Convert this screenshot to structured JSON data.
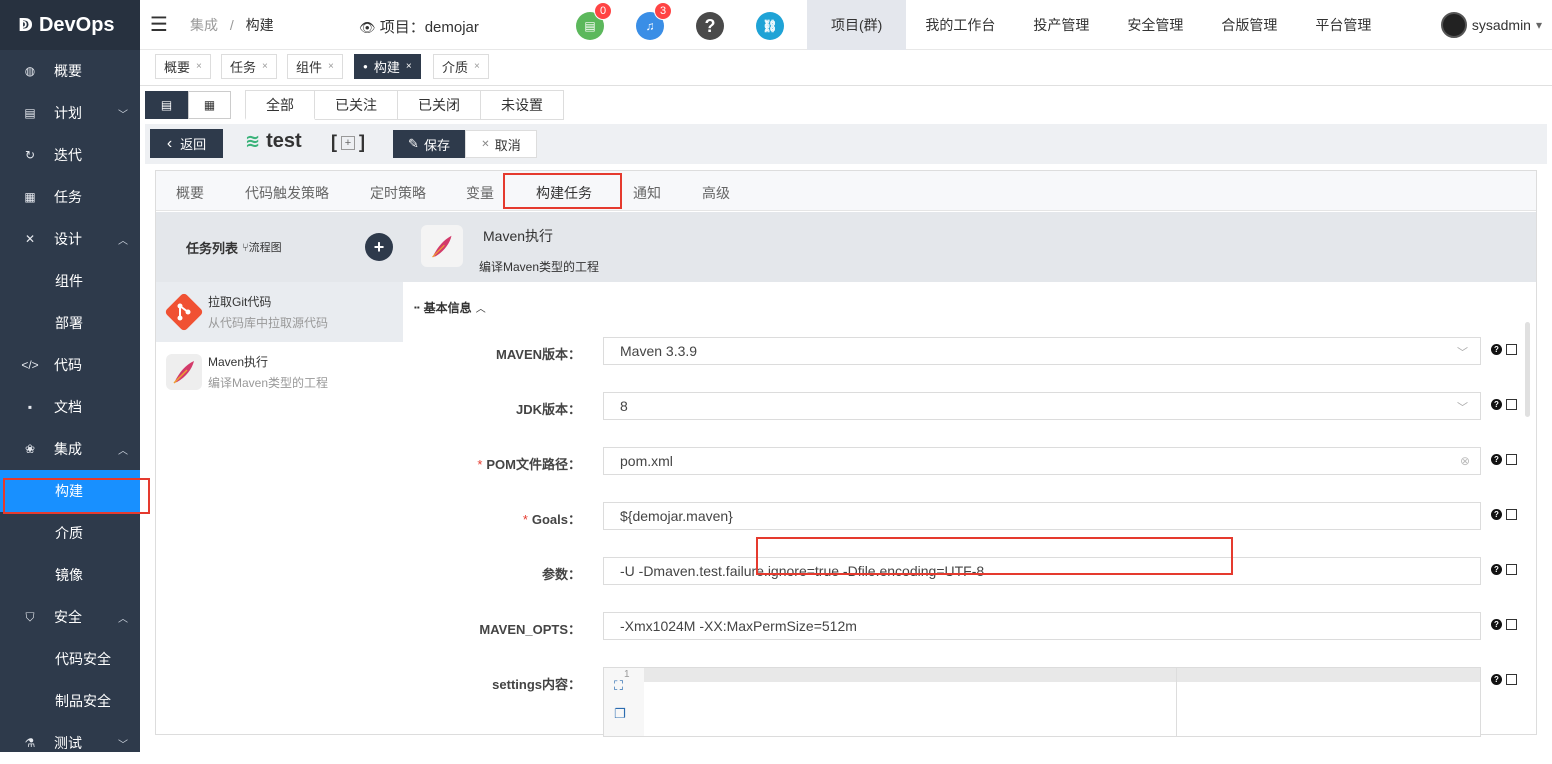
{
  "app": {
    "logo_mark": "ↁ",
    "logo_text": "DevOps"
  },
  "sidebar": {
    "items": [
      {
        "label": "概要",
        "icon": "dashboard-icon",
        "glyph": "◍"
      },
      {
        "label": "计划",
        "icon": "plan-icon",
        "glyph": "▤",
        "chevron": "﹀"
      },
      {
        "label": "迭代",
        "icon": "iteration-icon",
        "glyph": "↻"
      },
      {
        "label": "任务",
        "icon": "task-icon",
        "glyph": "▦"
      },
      {
        "label": "设计",
        "icon": "design-icon",
        "glyph": "✕",
        "chevron": "︿"
      },
      {
        "label": "组件"
      },
      {
        "label": "部署"
      },
      {
        "label": "代码",
        "icon": "code-icon",
        "glyph": "</>"
      },
      {
        "label": "文档",
        "icon": "doc-icon",
        "glyph": "▪"
      },
      {
        "label": "集成",
        "icon": "integration-icon",
        "glyph": "❀",
        "chevron": "︿"
      },
      {
        "label": "构建"
      },
      {
        "label": "介质"
      },
      {
        "label": "镜像"
      },
      {
        "label": "安全",
        "icon": "shield-icon",
        "glyph": "⛉",
        "chevron": "︿"
      },
      {
        "label": "代码安全"
      },
      {
        "label": "制品安全"
      },
      {
        "label": "测试",
        "icon": "test-icon",
        "glyph": "⚗",
        "chevron": "﹀"
      }
    ]
  },
  "topbar": {
    "hamburger": "☰",
    "breadcrumb_parent": "集成",
    "breadcrumb_sep": "/",
    "breadcrumb_current": "构建",
    "project_eye": "👁",
    "project_label": "项目：demojar",
    "notif1_count": "0",
    "notif2_count": "3",
    "help": "?",
    "link": "⛓",
    "menu": [
      "项目(群)",
      "我的工作台",
      "投产管理",
      "安全管理",
      "合版管理",
      "平台管理"
    ],
    "user": "sysadmin",
    "user_caret": "▾",
    "colors": {
      "green": "#5cb85c",
      "blue": "#3a8ee6",
      "gray": "#4a4a4a",
      "teal": "#1fa3d6"
    }
  },
  "page_tabs": [
    {
      "label": "概要",
      "close": "×"
    },
    {
      "label": "任务",
      "close": "×"
    },
    {
      "label": "组件",
      "close": "×"
    },
    {
      "label": "构建",
      "close": "×",
      "dot": "●"
    },
    {
      "label": "介质",
      "close": "×"
    }
  ],
  "view_switch": {
    "list": "▤",
    "grid": "▦"
  },
  "filter_tabs": [
    "全部",
    "已关注",
    "已关闭",
    "未设置"
  ],
  "toolbar": {
    "back_arrow": "‹",
    "back_label": "返回",
    "name_icon": "≋",
    "name": "test",
    "bracket_open": "[",
    "bracket_box": "+",
    "bracket_close": "]",
    "save_icon": "✎",
    "save_label": "保存",
    "cancel_icon": "✕",
    "cancel_label": "取消"
  },
  "section_tabs": [
    "概要",
    "代码触发策略",
    "定时策略",
    "变量",
    "构建任务",
    "通知",
    "高级"
  ],
  "task_list": {
    "title": "任务列表",
    "flow_icon": "⑂",
    "flow_label": "流程图",
    "add": "+",
    "items": [
      {
        "name": "拉取Git代码",
        "desc": "从代码库中拉取源代码"
      },
      {
        "name": "Maven执行",
        "desc": "编译Maven类型的工程"
      }
    ]
  },
  "detail": {
    "title": "Maven执行",
    "desc": "编译Maven类型的工程",
    "section_icon": "▪▪",
    "section": "基本信息",
    "section_caret": "︿",
    "fields": [
      {
        "label": "MAVEN版本：",
        "required": false,
        "value": "Maven 3.3.9",
        "type": "select"
      },
      {
        "label": "JDK版本：",
        "required": false,
        "value": "8",
        "type": "select"
      },
      {
        "label": "POM文件路径：",
        "required": true,
        "value": "pom.xml",
        "type": "text"
      },
      {
        "label": "Goals：",
        "required": true,
        "value": "${demojar.maven}",
        "type": "text"
      },
      {
        "label": "参数：",
        "required": false,
        "value": "-U -Dmaven.test.failure.ignore=true -Dfile.encoding=UTF-8",
        "type": "text"
      },
      {
        "label": "MAVEN_OPTS：",
        "required": false,
        "value": "-Xmx1024M -XX:MaxPermSize=512m",
        "type": "text"
      },
      {
        "label": "settings内容：",
        "required": false,
        "value": "",
        "type": "editor"
      }
    ],
    "editor_line_no": "1",
    "editor_fullscreen": "⛶",
    "editor_copy": "❐",
    "required_mark": "*",
    "dropdown_caret": "﹀",
    "clear_icon": "⊗",
    "help_glyph": "?"
  }
}
